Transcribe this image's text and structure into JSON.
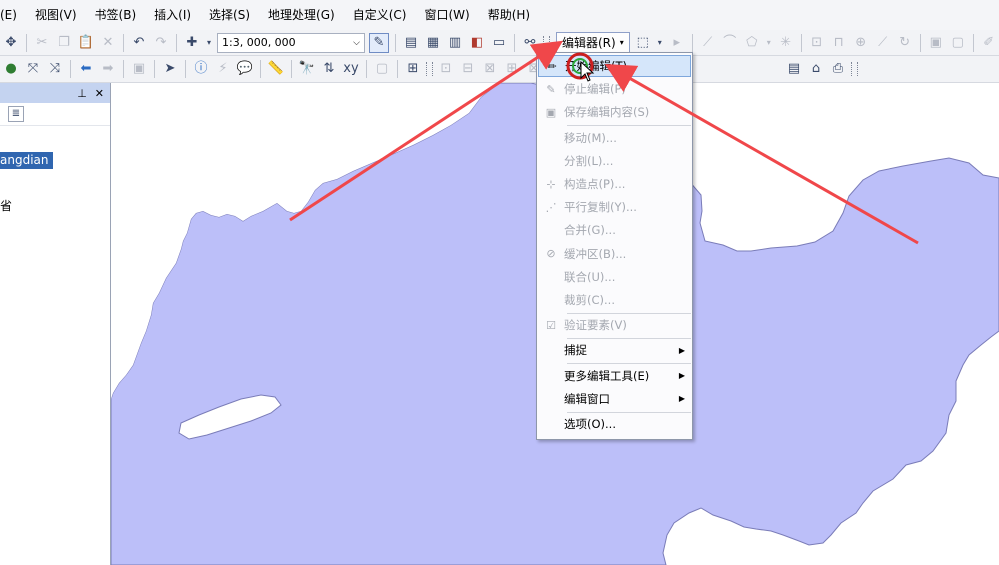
{
  "menubar": {
    "items": [
      {
        "label": "(E)",
        "name": "menu-edit"
      },
      {
        "label": "视图(V)",
        "name": "menu-view"
      },
      {
        "label": "书签(B)",
        "name": "menu-bookmarks"
      },
      {
        "label": "插入(I)",
        "name": "menu-insert"
      },
      {
        "label": "选择(S)",
        "name": "menu-selection"
      },
      {
        "label": "地理处理(G)",
        "name": "menu-geoprocessing"
      },
      {
        "label": "自定义(C)",
        "name": "menu-customize"
      },
      {
        "label": "窗口(W)",
        "name": "menu-windows"
      },
      {
        "label": "帮助(H)",
        "name": "menu-help"
      }
    ]
  },
  "toolbar": {
    "scale_value": "1:3, 000, 000",
    "editor_label": "编辑器(R)"
  },
  "toc": {
    "pin_glyph": "⊥",
    "close_glyph": "✕",
    "layer_selected": "angdian",
    "layer_sub": "省"
  },
  "editor_menu": {
    "items": [
      {
        "label": "开始编辑(T)",
        "name": "menu-start-editing",
        "icon": "pencil-icon",
        "glyph": "✏",
        "enabled": true,
        "highlight": true,
        "submenu": false
      },
      {
        "label": "停止编辑(P)",
        "name": "menu-stop-editing",
        "icon": "stop-edit-icon",
        "glyph": "✎",
        "enabled": false,
        "highlight": false,
        "submenu": false
      },
      {
        "label": "保存编辑内容(S)",
        "name": "menu-save-edits",
        "icon": "save-icon",
        "glyph": "▣",
        "enabled": false,
        "highlight": false,
        "submenu": false,
        "sep_after": true
      },
      {
        "label": "移动(M)...",
        "name": "menu-move",
        "icon": "",
        "glyph": "",
        "enabled": false,
        "highlight": false,
        "submenu": false
      },
      {
        "label": "分割(L)...",
        "name": "menu-split",
        "icon": "",
        "glyph": "",
        "enabled": false,
        "highlight": false,
        "submenu": false
      },
      {
        "label": "构造点(P)...",
        "name": "menu-construct-points",
        "icon": "construct-points-icon",
        "glyph": "⊹",
        "enabled": false,
        "highlight": false,
        "submenu": false
      },
      {
        "label": "平行复制(Y)...",
        "name": "menu-copy-parallel",
        "icon": "copy-parallel-icon",
        "glyph": "⋰",
        "enabled": false,
        "highlight": false,
        "submenu": false
      },
      {
        "label": "合并(G)...",
        "name": "menu-merge",
        "icon": "",
        "glyph": "",
        "enabled": false,
        "highlight": false,
        "submenu": false
      },
      {
        "label": "缓冲区(B)...",
        "name": "menu-buffer",
        "icon": "buffer-icon",
        "glyph": "⊘",
        "enabled": false,
        "highlight": false,
        "submenu": false
      },
      {
        "label": "联合(U)...",
        "name": "menu-union",
        "icon": "",
        "glyph": "",
        "enabled": false,
        "highlight": false,
        "submenu": false
      },
      {
        "label": "裁剪(C)...",
        "name": "menu-clip",
        "icon": "",
        "glyph": "",
        "enabled": false,
        "highlight": false,
        "submenu": false,
        "sep_after": true
      },
      {
        "label": "验证要素(V)",
        "name": "menu-validate-features",
        "icon": "validate-icon",
        "glyph": "☑",
        "enabled": false,
        "highlight": false,
        "submenu": false,
        "sep_after": true
      },
      {
        "label": "捕捉",
        "name": "menu-snapping",
        "icon": "",
        "glyph": "",
        "enabled": true,
        "highlight": false,
        "submenu": true,
        "sep_after": true
      },
      {
        "label": "更多编辑工具(E)",
        "name": "menu-more-editing-tools",
        "icon": "",
        "glyph": "",
        "enabled": true,
        "highlight": false,
        "submenu": true
      },
      {
        "label": "编辑窗口",
        "name": "menu-editing-windows",
        "icon": "",
        "glyph": "",
        "enabled": true,
        "highlight": false,
        "submenu": true,
        "sep_after": true
      },
      {
        "label": "选项(O)...",
        "name": "menu-options",
        "icon": "",
        "glyph": "",
        "enabled": true,
        "highlight": false,
        "submenu": false
      }
    ],
    "submenu_arrow": "▶"
  },
  "colors": {
    "land_fill": "#bcbff9",
    "land_stroke": "#7a7cb8",
    "annotation_red": "#f0474a",
    "highlight_circle": "#cc1f1f",
    "cursor_circle": "#2aa83a",
    "selection_blue": "#3066b0",
    "panel_title": "#c4d3f0"
  }
}
